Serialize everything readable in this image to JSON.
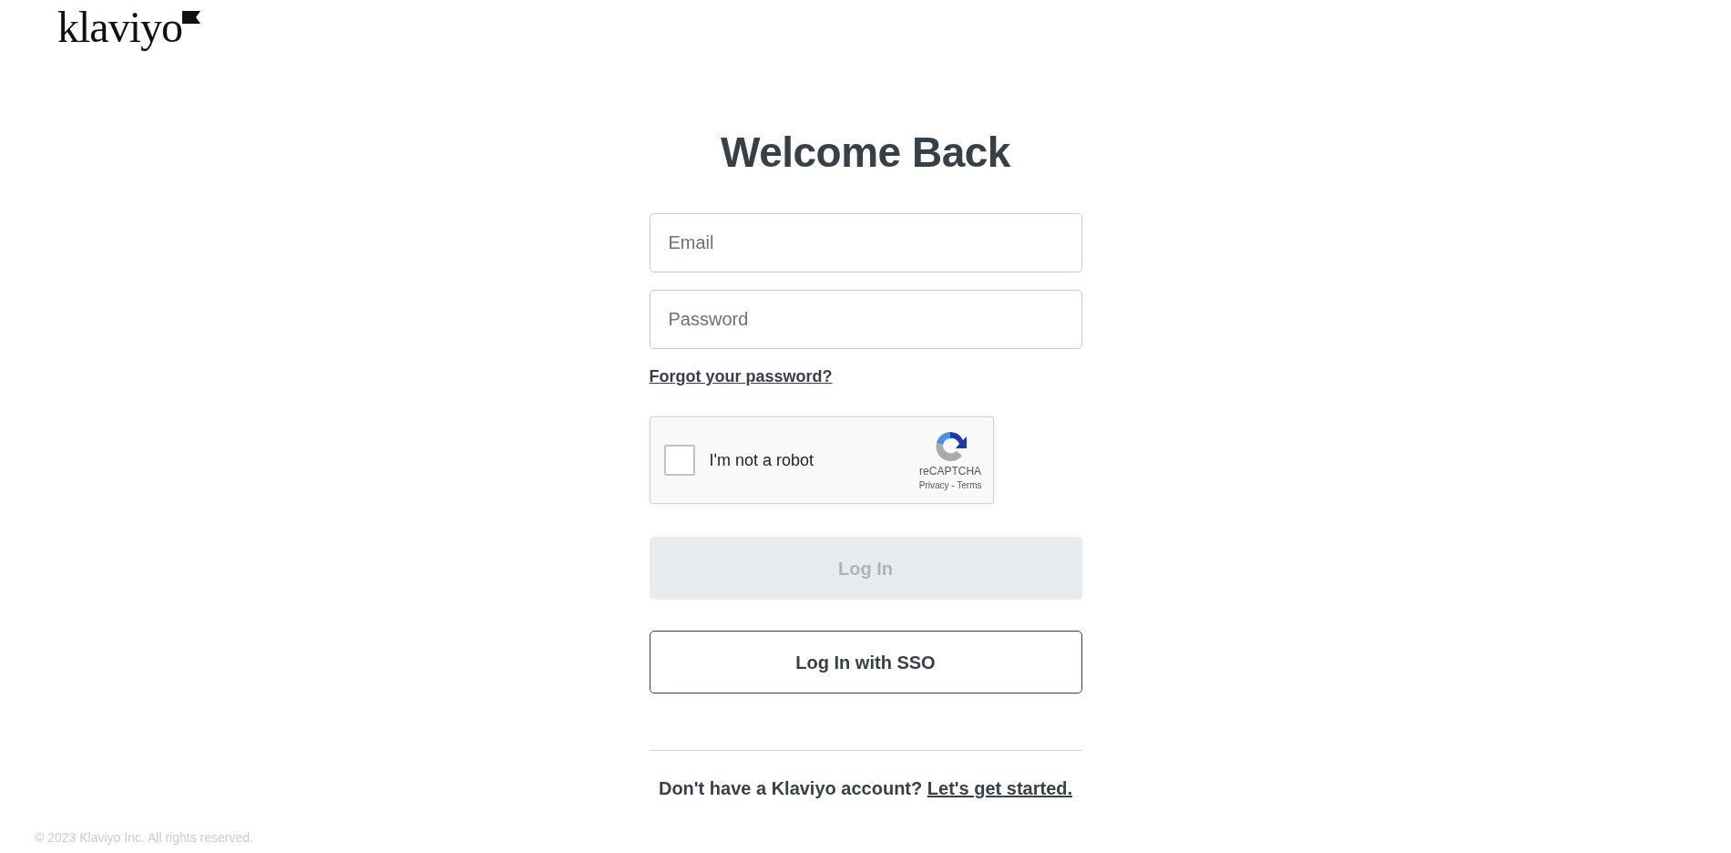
{
  "logo": {
    "text": "klaviyo"
  },
  "title": "Welcome Back",
  "fields": [
    {
      "placeholder": "Email"
    },
    {
      "placeholder": "Password"
    }
  ],
  "forgot_link": "Forgot your password?",
  "captcha": {
    "label": "I'm not a robot",
    "checked": false,
    "brand": "reCAPTCHA",
    "privacy": "Privacy",
    "separator": "-",
    "terms": "Terms"
  },
  "login_button": {
    "label": "Log In",
    "disabled": true
  },
  "sso_button": {
    "label": "Log In with SSO"
  },
  "signup": {
    "text": "Don't have a Klaviyo account?",
    "link": "Let's get started."
  },
  "copyright": "© 2023 Klaviyo Inc. All rights reserved."
}
